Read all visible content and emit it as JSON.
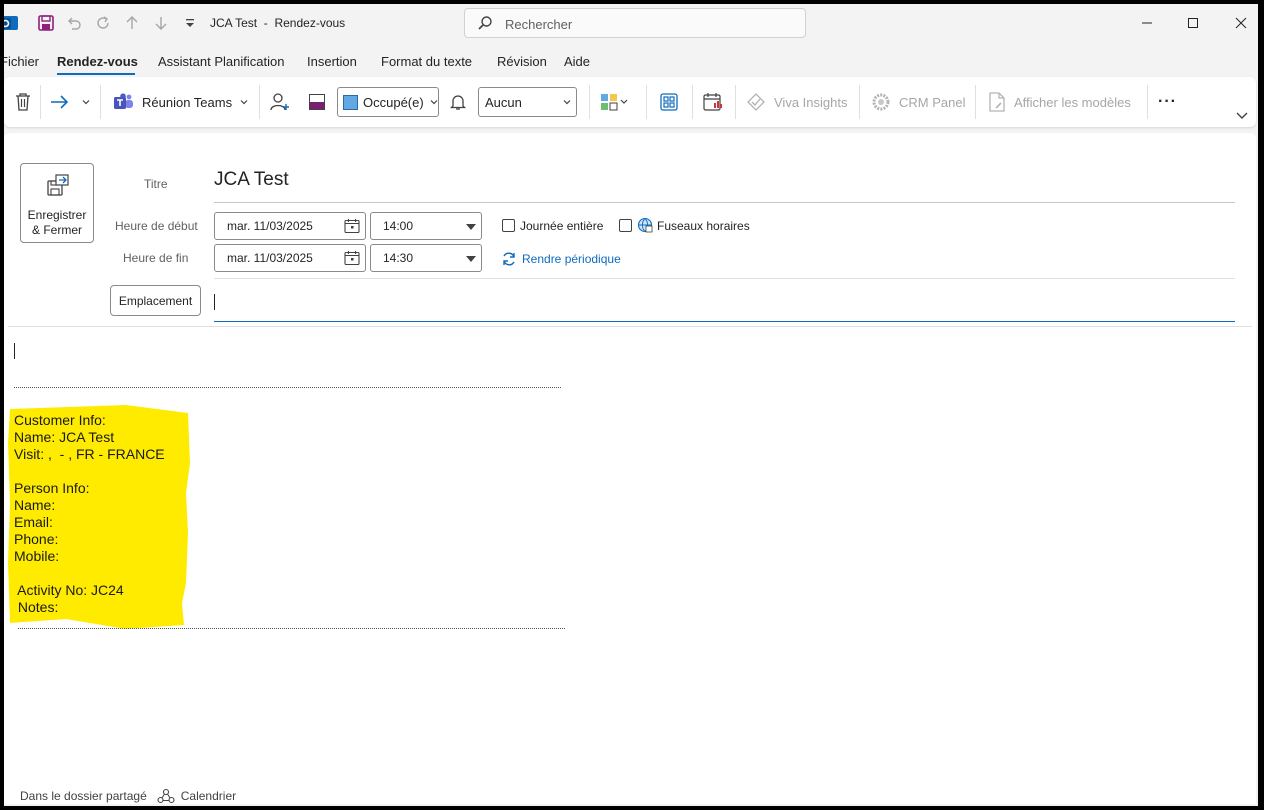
{
  "titlebar": {
    "title": "JCA Test  -  Rendez-vous",
    "search_placeholder": "Rechercher"
  },
  "menu": {
    "tabs": [
      {
        "label": "Fichier"
      },
      {
        "label": "Rendez-vous",
        "active": true
      },
      {
        "label": "Assistant Planification"
      },
      {
        "label": "Insertion"
      },
      {
        "label": "Format du texte"
      },
      {
        "label": "Révision"
      },
      {
        "label": "Aide"
      }
    ]
  },
  "ribbon": {
    "teams_label": "Réunion Teams",
    "show_as": "Occupé(e)",
    "reminder": "Aucun",
    "viva_label": "Viva Insights",
    "crm_label": "CRM Panel",
    "templates_label": "Afficher les modèles",
    "more_label": "···"
  },
  "form": {
    "save_label": "Enregistrer\n& Fermer",
    "title_label": "Titre",
    "title_value": "JCA Test",
    "start_label": "Heure de début",
    "end_label": "Heure de fin",
    "start_date": "mar. 11/03/2025",
    "start_time": "14:00",
    "end_date": "mar. 11/03/2025",
    "end_time": "14:30",
    "all_day_label": "Journée entière",
    "all_day_checked": false,
    "timezones_label": "Fuseaux horaires",
    "timezones_checked": false,
    "recurring_label": "Rendre périodique",
    "location_label": "Emplacement",
    "location_value": ""
  },
  "body": {
    "highlight_color": "#ffeb00",
    "lines": [
      "Customer Info:",
      "Name: JCA Test",
      "Visit: ,  - , FR - FRANCE",
      "",
      "Person Info:",
      "Name:",
      "Email:",
      "Phone:",
      "Mobile:",
      "",
      " Activity No: JC24",
      " Notes:"
    ]
  },
  "statusbar": {
    "folder_label": "Dans le dossier partagé",
    "calendar_label": "Calendrier"
  },
  "colors": {
    "accent": "#0f6cbd",
    "outlook_blue": "#0f6cbd",
    "save_purple": "#8f1f7a"
  }
}
